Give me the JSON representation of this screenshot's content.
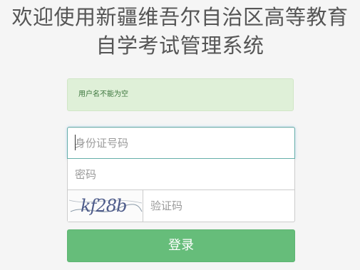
{
  "header": {
    "title_line1": "欢迎使用新疆维吾尔自治区高等教育",
    "title_line2": "自学考试管理系统"
  },
  "alert": {
    "message": "用户名不能为空",
    "color": "#dff0d8"
  },
  "form": {
    "id_placeholder": "身份证号码",
    "password_placeholder": "密码",
    "captcha_text": "kf28b",
    "captcha_placeholder": "验证码",
    "login_label": "登录",
    "login_color": "#66bd7a"
  }
}
